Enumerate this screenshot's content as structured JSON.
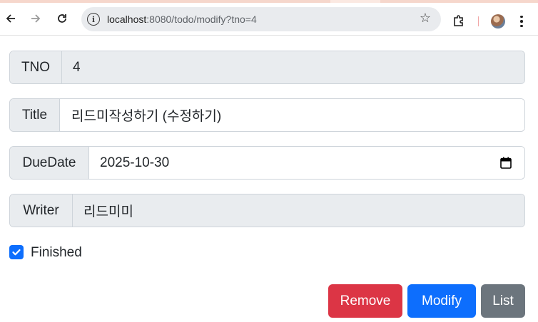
{
  "browser": {
    "url_host": "localhost",
    "url_path": ":8080/todo/modify?tno=4"
  },
  "form": {
    "tno": {
      "label": "TNO",
      "value": "4"
    },
    "title": {
      "label": "Title",
      "value": "리드미작성하기 (수정하기)"
    },
    "duedate": {
      "label": "DueDate",
      "value": "2025-10-30"
    },
    "writer": {
      "label": "Writer",
      "value": "리드미미"
    },
    "finished": {
      "label": "Finished",
      "checked": true
    }
  },
  "buttons": {
    "remove": "Remove",
    "modify": "Modify",
    "list": "List"
  },
  "colors": {
    "remove": "#dc3545",
    "modify": "#0d6efd",
    "list": "#6c757d",
    "readonly_bg": "#e9ecef"
  },
  "icons": [
    "back-arrow-icon",
    "forward-arrow-icon",
    "reload-icon",
    "info-icon",
    "star-icon",
    "extensions-icon",
    "calendar-icon",
    "checkmark-icon",
    "kebab-menu-icon"
  ]
}
